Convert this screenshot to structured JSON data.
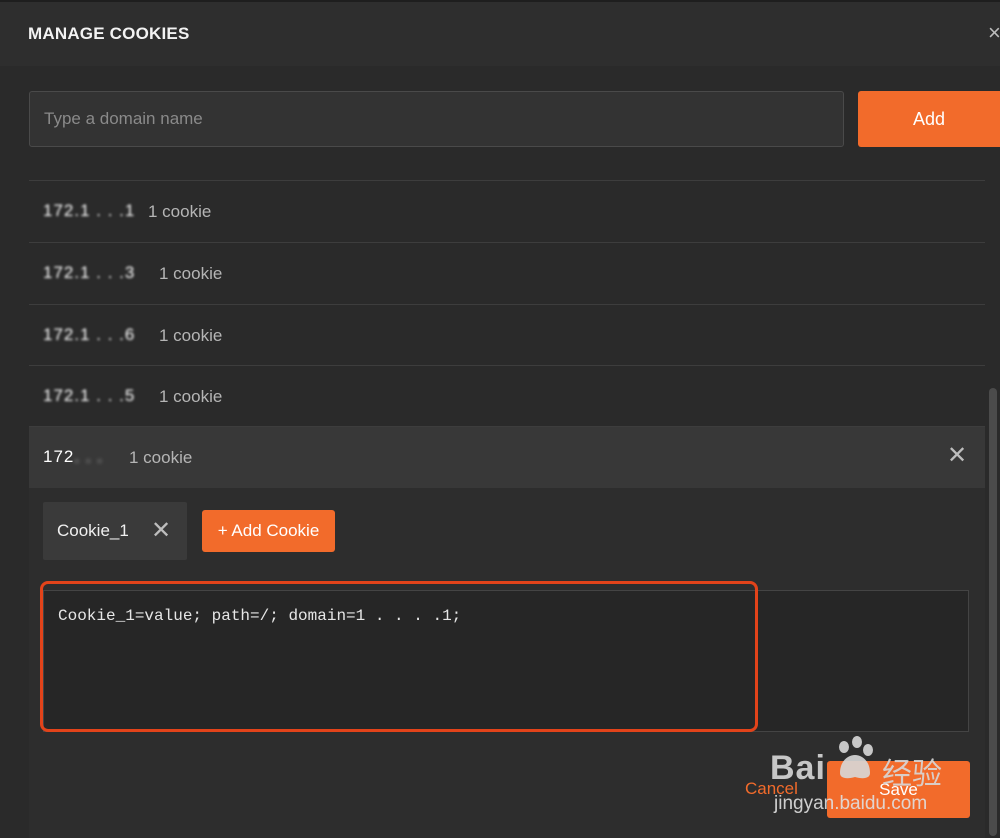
{
  "modal": {
    "title": "MANAGE COOKIES",
    "close_glyph": "×"
  },
  "domain_input": {
    "placeholder": "Type a domain name",
    "value": ""
  },
  "add_button": {
    "label": "Add"
  },
  "domains": [
    {
      "domain": "172.1 . . .1",
      "count": "1 cookie"
    },
    {
      "domain": "172.1 . . .3",
      "count": "1 cookie"
    },
    {
      "domain": "172.1 . . .6",
      "count": "1 cookie"
    },
    {
      "domain": "172.1 . . .5",
      "count": "1 cookie"
    }
  ],
  "expanded_domain": {
    "domain_visible": "172",
    "domain_blurred": ". . .",
    "count": "1 cookie",
    "close_glyph": "✕",
    "cookie_tab": {
      "label": "Cookie_1",
      "close_glyph": "✕"
    },
    "add_cookie_button": {
      "label": "+ Add Cookie"
    },
    "cookie_string": "Cookie_1=value; path=/; domain=1 . . . .1;",
    "cancel_label": "Cancel",
    "save_label": "Save"
  },
  "watermark": {
    "brand": "Bai",
    "brand_cn": "经验",
    "url": "jingyan.baidu.com"
  },
  "colors": {
    "accent": "#f26b2b",
    "highlight": "#e2431a",
    "background": "#2a2a2a"
  }
}
